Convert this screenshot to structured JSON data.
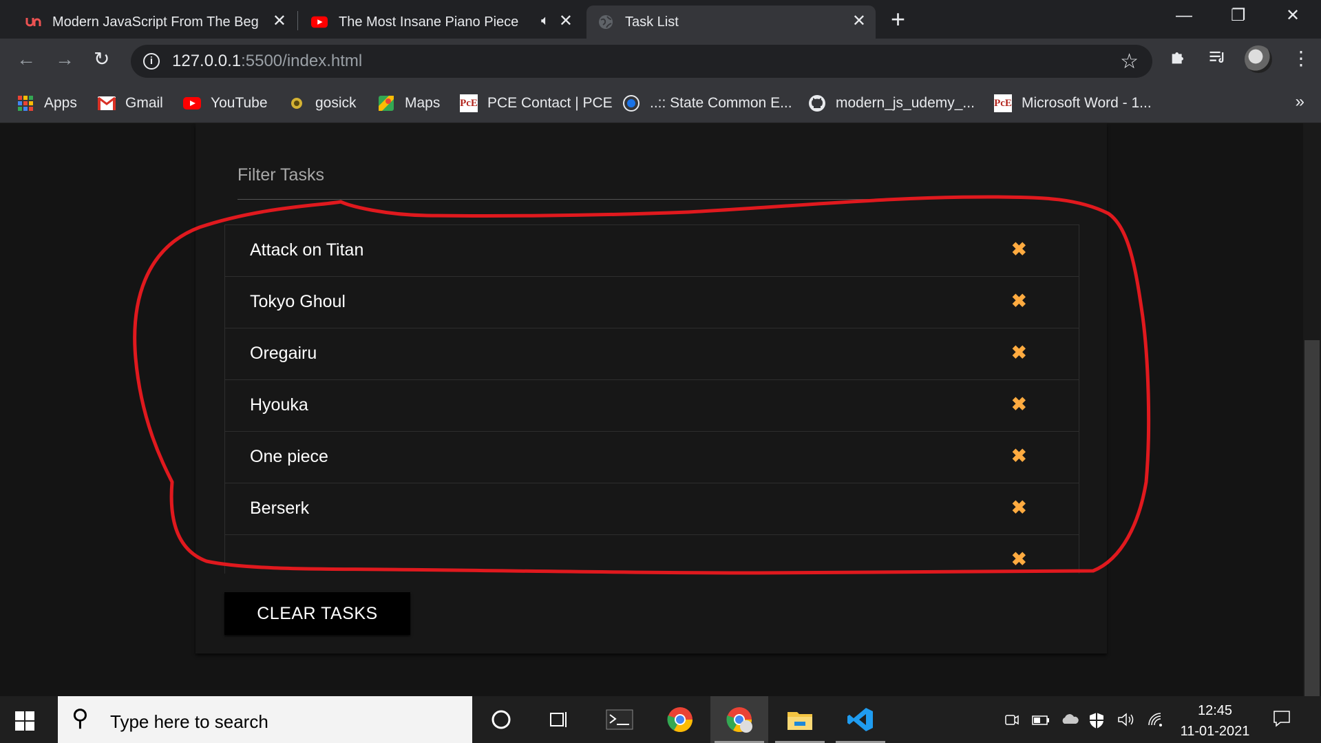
{
  "browser": {
    "tabs": [
      {
        "title": "Modern JavaScript From The Beg",
        "favicon": "udemy-icon",
        "active": false
      },
      {
        "title": "The Most Insane Piano Piece",
        "favicon": "youtube-icon",
        "audio": true,
        "active": false
      },
      {
        "title": "Task List",
        "favicon": "globe-icon",
        "active": true
      }
    ],
    "new_tab": "+",
    "window_controls": {
      "minimize": "—",
      "restore": "❐",
      "close": "✕"
    },
    "address": {
      "host": "127.0.0.1",
      "rest": ":5500/index.html"
    },
    "bookmarks": [
      {
        "label": "Apps",
        "icon": "apps-grid-icon"
      },
      {
        "label": "Gmail",
        "icon": "gmail-icon"
      },
      {
        "label": "YouTube",
        "icon": "youtube-icon"
      },
      {
        "label": "gosick",
        "icon": "gosick-icon"
      },
      {
        "label": "Maps",
        "icon": "maps-icon"
      },
      {
        "label": "PCE Contact | PCE",
        "icon": "pce-icon"
      },
      {
        "label": "..:: State Common E...",
        "icon": "cet-icon"
      },
      {
        "label": "modern_js_udemy_...",
        "icon": "github-icon"
      },
      {
        "label": "Microsoft Word - 1...",
        "icon": "pce-icon"
      }
    ],
    "bookmarks_overflow": "»"
  },
  "app": {
    "filter_placeholder": "Filter Tasks",
    "tasks": [
      "Attack on Titan",
      "Tokyo Ghoul",
      "Oregairu",
      "Hyouka",
      "One piece",
      "Berserk",
      ""
    ],
    "delete_glyph": "✖",
    "clear_button": "CLEAR TASKS",
    "accent_color": "#ffab40",
    "annotation_color": "#e0191e"
  },
  "taskbar": {
    "search_placeholder": "Type here to search",
    "time": "12:45",
    "date": "11-01-2021"
  }
}
